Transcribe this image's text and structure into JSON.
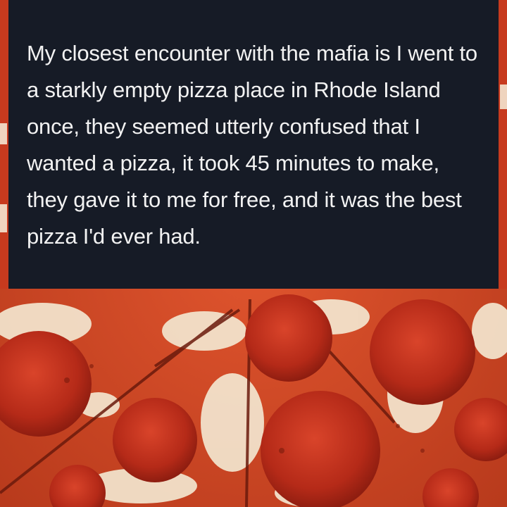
{
  "post": {
    "text": "My closest encounter with the mafia is I went to a starkly empty pizza place in Rhode Island once, they seemed utterly confused that I wanted a pizza, it took 45 minutes to make, they gave it to me for free, and it was the best pizza I'd ever had."
  },
  "colors": {
    "panel_background": "#161b26",
    "text": "#f2f2f2",
    "sauce": "#c8321a",
    "pepperoni": "#b52a18",
    "cheese": "#f3e6cf"
  },
  "background_image": {
    "subject": "pepperoni pizza slices",
    "icon": "pizza-photo"
  }
}
